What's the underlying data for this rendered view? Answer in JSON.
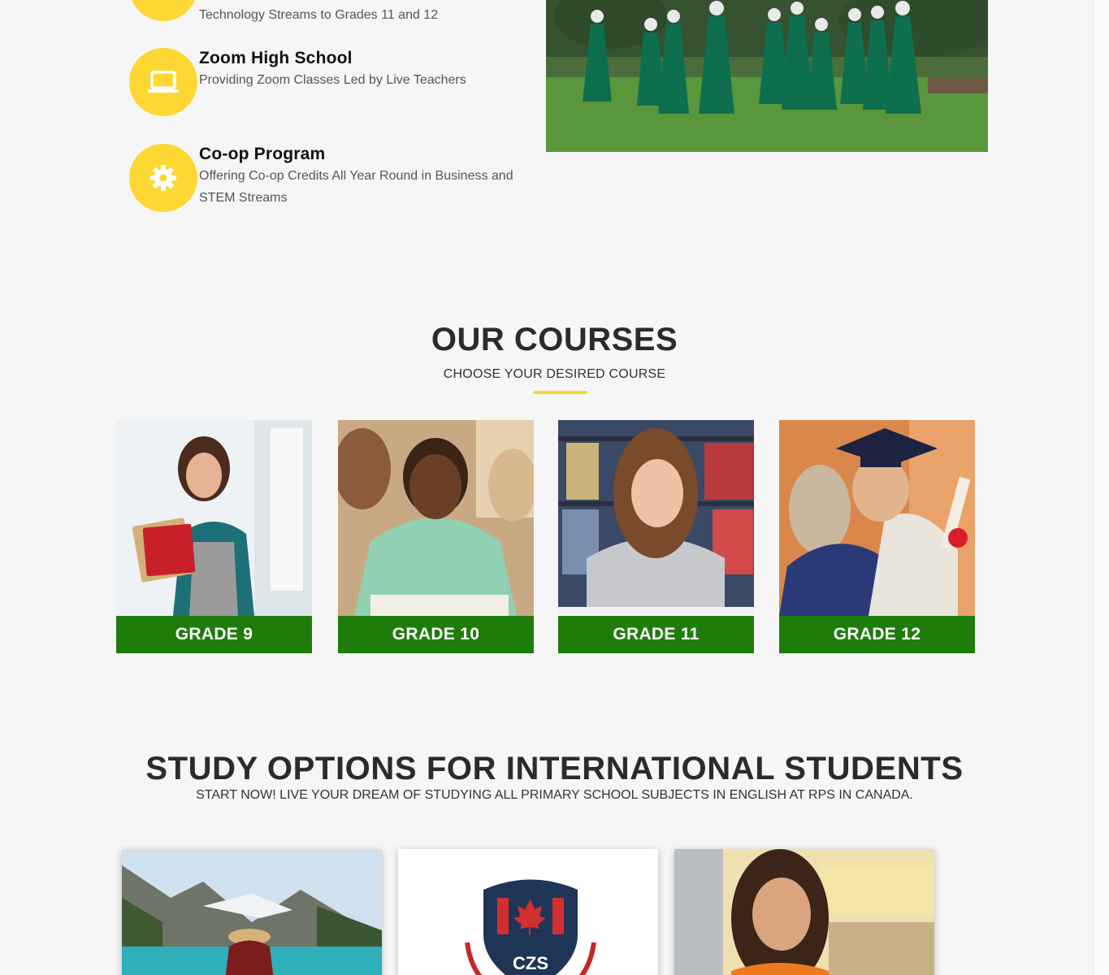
{
  "features": [
    {
      "title": "",
      "desc": "Technology Streams to Grades 11 and 12",
      "icon": "book-icon"
    },
    {
      "title": "Zoom High School",
      "desc": "Providing Zoom Classes Led by Live Teachers",
      "icon": "laptop-icon"
    },
    {
      "title": "Co-op Program",
      "desc": "Offering Co-op Credits All Year Round in Business and STEM Streams",
      "icon": "gear-icon"
    }
  ],
  "courses": {
    "title": "OUR COURSES",
    "subtitle": "CHOOSE YOUR DESIRED COURSE",
    "items": [
      {
        "label": "GRADE 9"
      },
      {
        "label": "GRADE 10"
      },
      {
        "label": "GRADE 11"
      },
      {
        "label": "GRADE 12"
      }
    ]
  },
  "international": {
    "title": "STUDY OPTIONS FOR INTERNATIONAL STUDENTS",
    "subtitle": "START NOW! LIVE YOUR DREAM OF STUDYING ALL PRIMARY SCHOOL SUBJECTS IN ENGLISH AT RPS IN CANADA.",
    "logo_text": "CZS"
  },
  "colors": {
    "accent_yellow": "#fdd835",
    "grade_green": "#1e7d0a",
    "logo_navy": "#1f3557",
    "logo_red": "#d32f2f"
  }
}
